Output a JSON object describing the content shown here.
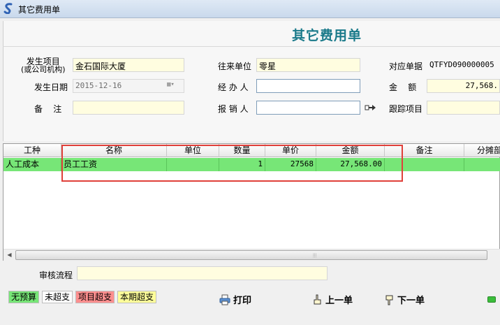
{
  "window": {
    "title": "其它费用单"
  },
  "heading": "其它费用单",
  "form": {
    "project": {
      "label": "发生项目",
      "sublabel": "(或公司机构)",
      "value": "金石国际大厦"
    },
    "partner": {
      "label": "往来单位",
      "value": "零星"
    },
    "ref_doc": {
      "label": "对应单据",
      "value": "QTFYD090000005"
    },
    "date": {
      "label": "发生日期",
      "value": "2015-12-16"
    },
    "handler": {
      "label": "经 办 人",
      "value": ""
    },
    "amount": {
      "label": "金    额",
      "value": "27,568."
    },
    "remark": {
      "label": "备    注",
      "value": ""
    },
    "reimburser": {
      "label": "报 销 人",
      "value": ""
    },
    "tracking": {
      "label": "跟踪项目",
      "value": ""
    }
  },
  "table": {
    "columns": [
      "工种",
      "名称",
      "单位",
      "数量",
      "单价",
      "金额",
      "备注",
      "分摊部"
    ],
    "rows": [
      {
        "type": "人工成本",
        "name": "员工工资",
        "unit": "",
        "qty": "1",
        "price": "27568",
        "amount": "27,568.00",
        "note": "",
        "dept": ""
      }
    ]
  },
  "approval": {
    "label": "审核流程",
    "value": ""
  },
  "legend": [
    {
      "label": "无预算",
      "color": "#77e677"
    },
    {
      "label": "未超支",
      "color": "#ffffff"
    },
    {
      "label": "项目超支",
      "color": "#ff8f8f"
    },
    {
      "label": "本期超支",
      "color": "#ffff9a"
    }
  ],
  "toolbar": {
    "print": "打印",
    "prev": "上一单",
    "next": "下一单"
  },
  "colors": {
    "heading": "#1a7a8a",
    "selected_row": "#77e677",
    "field_bg": "#fffde0",
    "highlight": "#e0403a"
  }
}
